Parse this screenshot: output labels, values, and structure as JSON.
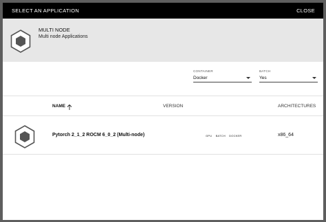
{
  "dialog": {
    "title": "SELECT AN APPLICATION",
    "close_label": "CLOSE"
  },
  "header": {
    "icon": "hexagon-app-icon",
    "name": "MULTI NODE",
    "description": "Multi node Applications"
  },
  "filters": {
    "container": {
      "label": "CONTAINER",
      "value": "Docker"
    },
    "batch": {
      "label": "BATCH",
      "value": "Yes"
    }
  },
  "table": {
    "columns": {
      "name": "NAME",
      "version": "VERSION",
      "architectures": "ARCHITECTURES"
    },
    "sort_icon": "arrow-up-icon",
    "rows": [
      {
        "icon": "hexagon-app-icon",
        "name": "Pytorch 2_1_2 ROCM 6_0_2 (Multi-node)",
        "version": "",
        "tags": [
          "GPU",
          "BATCH",
          "DOCKER"
        ],
        "architectures": "x86_64"
      }
    ]
  },
  "colors": {
    "titlebar": "#000000",
    "header_bg": "#e7e7e7",
    "backdrop": "#5e5e5e",
    "icon_fill": "#555555"
  }
}
